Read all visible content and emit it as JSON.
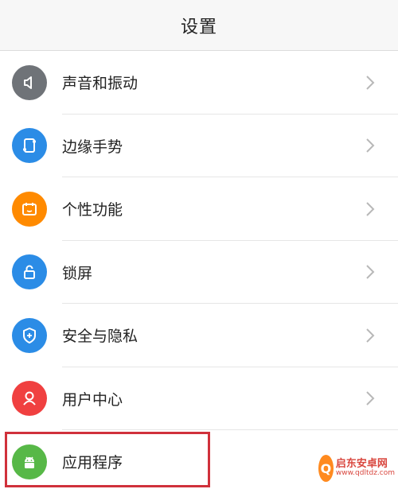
{
  "header": {
    "title": "设置"
  },
  "items": [
    {
      "label": "声音和振动",
      "icon": "speaker-icon",
      "color": "#6f7378"
    },
    {
      "label": "边缘手势",
      "icon": "edge-gesture-icon",
      "color": "#2b8ce6"
    },
    {
      "label": "个性功能",
      "icon": "personal-feature-icon",
      "color": "#ff8a00"
    },
    {
      "label": "锁屏",
      "icon": "lock-icon",
      "color": "#2b8ce6"
    },
    {
      "label": "安全与隐私",
      "icon": "shield-icon",
      "color": "#2b8ce6"
    },
    {
      "label": "用户中心",
      "icon": "user-icon",
      "color": "#f04040"
    },
    {
      "label": "应用程序",
      "icon": "android-icon",
      "color": "#57b847"
    }
  ],
  "highlight_color": "#d0313b",
  "watermark": {
    "name": "启东安卓网",
    "url": "www.qdltdz.com"
  }
}
